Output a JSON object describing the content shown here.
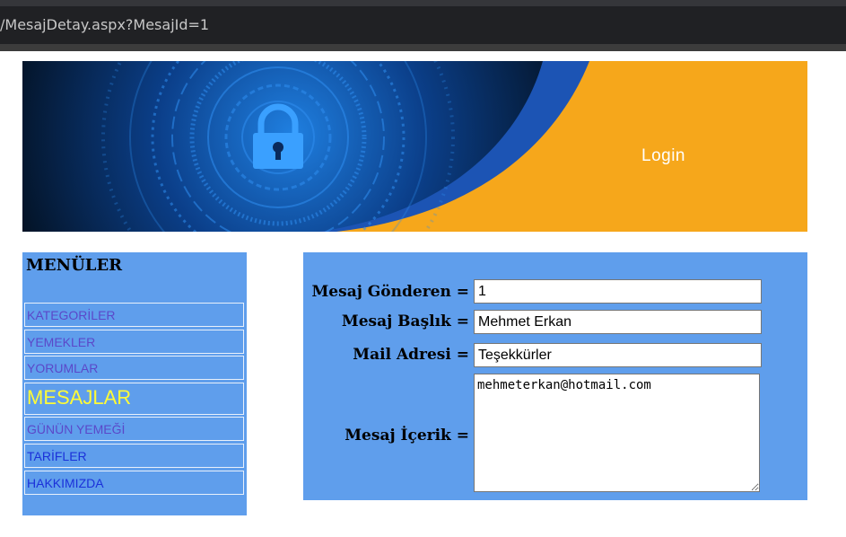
{
  "browser": {
    "url": "/MesajDetay.aspx?MesajId=1"
  },
  "banner": {
    "login_label": "Login"
  },
  "sidebar": {
    "title": "MENÜLER",
    "items": [
      {
        "label": "KATEGORİLER"
      },
      {
        "label": "YEMEKLER"
      },
      {
        "label": "YORUMLAR"
      },
      {
        "label": "MESAJLAR",
        "active": true
      },
      {
        "label": "GÜNÜN YEMEĞİ"
      },
      {
        "label": "TARİFLER"
      },
      {
        "label": "HAKKIMIZDA"
      }
    ]
  },
  "form": {
    "sender_label": "Mesaj Gönderen =",
    "sender_value": "1",
    "subject_label": "Mesaj Başlık =",
    "subject_value": "Mehmet Erkan",
    "mail_label": "Mail Adresi =",
    "mail_value": "Teşekkürler",
    "content_label": "Mesaj İçerik =",
    "content_value": "mehmeterkan@hotmail.com"
  },
  "colors": {
    "panel_bg": "#5f9eec",
    "active_menu_text": "#fffb36",
    "menu_text": "#5b48c9",
    "banner_orange": "#f6a71b",
    "banner_dark_blue": "#0a2a5c"
  }
}
